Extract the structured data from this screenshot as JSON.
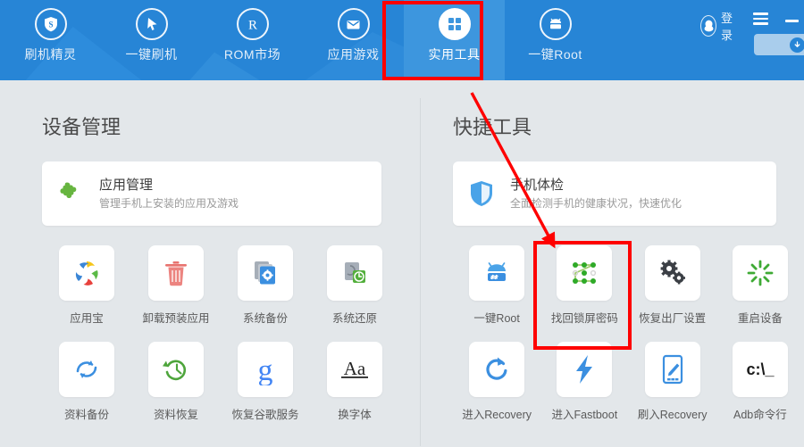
{
  "navbar": {
    "tabs": [
      {
        "label": "刷机精灵",
        "icon": "shield-s-icon",
        "active": false
      },
      {
        "label": "一键刷机",
        "icon": "cursor-icon",
        "active": false
      },
      {
        "label": "ROM市场",
        "icon": "registered-icon",
        "active": false
      },
      {
        "label": "应用游戏",
        "icon": "envelope-icon",
        "active": false
      },
      {
        "label": "实用工具",
        "icon": "grid-squares-icon",
        "active": true
      },
      {
        "label": "一键Root",
        "icon": "android-root-icon",
        "active": false
      }
    ],
    "login_label": "登录",
    "login_icon": "penguin-avatar-icon",
    "menu_icon": "hamburger-menu-icon",
    "minimize_icon": "minimize-icon",
    "download_icon": "download-circle-icon",
    "colors": {
      "bar": "#2785d6",
      "active_tab": "#3d96de",
      "download_box": "#a9cdec"
    }
  },
  "left": {
    "section_title": "设备管理",
    "feature_card": {
      "icon": "puzzle-piece-icon",
      "title": "应用管理",
      "subtitle": "管理手机上安装的应用及游戏"
    },
    "tiles": [
      {
        "label": "应用宝",
        "icon": "yingyongbao-pinwheel-icon"
      },
      {
        "label": "卸载预装应用",
        "icon": "trash-can-icon"
      },
      {
        "label": "系统备份",
        "icon": "documents-gear-icon"
      },
      {
        "label": "系统还原",
        "icon": "document-clock-icon"
      },
      {
        "label": "资料备份",
        "icon": "sync-arrows-icon"
      },
      {
        "label": "资料恢复",
        "icon": "restore-clock-icon"
      },
      {
        "label": "恢复谷歌服务",
        "icon": "google-g-icon"
      },
      {
        "label": "换字体",
        "icon": "font-aa-icon"
      }
    ]
  },
  "right": {
    "section_title": "快捷工具",
    "feature_card": {
      "icon": "shield-check-icon",
      "title": "手机体检",
      "subtitle": "全面检测手机的健康状况，快速优化"
    },
    "tiles": [
      {
        "label": "一键Root",
        "icon": "android-root-icon"
      },
      {
        "label": "找回锁屏密码",
        "icon": "pattern-lock-icon"
      },
      {
        "label": "恢复出厂设置",
        "icon": "gears-icon"
      },
      {
        "label": "重启设备",
        "icon": "restart-burst-icon"
      },
      {
        "label": "进入Recovery",
        "icon": "refresh-circle-icon"
      },
      {
        "label": "进入Fastboot",
        "icon": "lightning-bolt-icon"
      },
      {
        "label": "刷入Recovery",
        "icon": "phone-pencil-icon"
      },
      {
        "label": "Adb命令行",
        "icon": "command-prompt-icon"
      }
    ]
  },
  "annotations": {
    "color": "#fe0000",
    "boxes": [
      {
        "name": "toolbox-tab-highlight",
        "target": "实用工具"
      },
      {
        "name": "pattern-lock-highlight",
        "target": "找回锁屏密码"
      }
    ],
    "arrow": {
      "from_label": "实用工具",
      "to_label": "找回锁屏密码"
    }
  }
}
